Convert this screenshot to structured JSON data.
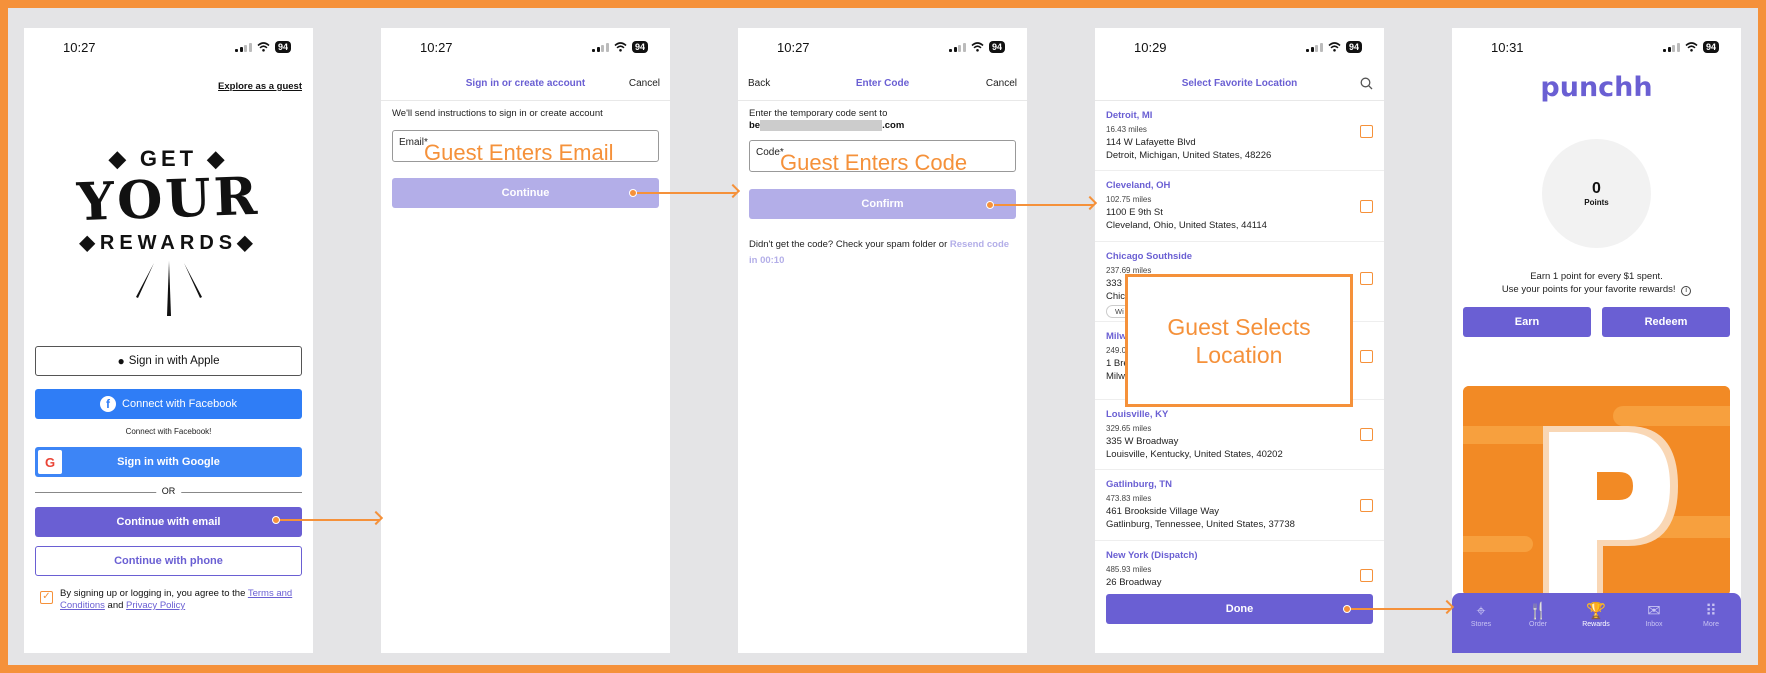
{
  "colors": {
    "accent": "#f5913a",
    "brand_purple": "#6a5fd3",
    "lavender": "#b3aee8",
    "facebook_blue": "#2f7df6"
  },
  "screen1": {
    "time": "10:27",
    "battery": "94",
    "explore": "Explore as a guest",
    "logo_line1": "GET",
    "logo_line2": "YOUR",
    "logo_line3": "REWARDS",
    "apple": "Sign in with Apple",
    "facebook": "Connect with Facebook",
    "facebook_note": "Connect with Facebook!",
    "google": "Sign in with Google",
    "or": "OR",
    "email": "Continue with email",
    "phone": "Continue with phone",
    "terms_prefix": "By signing up or logging in, you agree to the",
    "terms_link": "Terms and Conditions",
    "and": "and",
    "privacy_link": "Privacy Policy"
  },
  "screen2": {
    "time": "10:27",
    "battery": "94",
    "title": "Sign in or create account",
    "cancel": "Cancel",
    "instructions": "We'll send instructions to sign in or create account",
    "email_label": "Email*",
    "continue": "Continue",
    "overlay": "Guest Enters Email"
  },
  "screen3": {
    "time": "10:27",
    "battery": "94",
    "back": "Back",
    "title": "Enter Code",
    "cancel": "Cancel",
    "sent_to": "Enter the temporary code sent to",
    "email_prefix": "be",
    "email_suffix": ".com",
    "code_label": "Code*",
    "confirm": "Confirm",
    "help": "Didn't get the code? Check your spam folder or",
    "resend": "Resend code in 00:10",
    "overlay": "Guest Enters Code"
  },
  "screen4": {
    "time": "10:29",
    "battery": "94",
    "title": "Select Favorite Location",
    "locations": [
      {
        "name": "Detroit, MI",
        "miles": "16.43 miles",
        "addr1": "114 W Lafayette Blvd",
        "addr2": "Detroit, Michigan, United States, 48226"
      },
      {
        "name": "Cleveland, OH",
        "miles": "102.75 miles",
        "addr1": "1100 E 9th St",
        "addr2": "Cleveland, Ohio, United States, 44114"
      },
      {
        "name": "Chicago Southside",
        "miles": "237.69 miles",
        "addr1": "333 1",
        "addr2": "Chic",
        "chip": "Wi"
      },
      {
        "name": "Milw",
        "miles": "249.0",
        "addr1": "1 Bre",
        "addr2": "Milw"
      },
      {
        "name": "Louisville, KY",
        "miles": "329.65 miles",
        "addr1": "335 W Broadway",
        "addr2": "Louisville, Kentucky, United States, 40202"
      },
      {
        "name": "Gatlinburg, TN",
        "miles": "473.83 miles",
        "addr1": "461 Brookside Village Way",
        "addr2": "Gatlinburg, Tennessee, United States, 37738"
      },
      {
        "name": "New York (Dispatch)",
        "miles": "485.93 miles",
        "addr1": "26 Broadway",
        "addr2": ""
      }
    ],
    "done": "Done",
    "overlay_line1": "Guest Selects",
    "overlay_line2": "Location"
  },
  "screen5": {
    "time": "10:31",
    "battery": "94",
    "brand": "punchh",
    "points_value": "0",
    "points_label": "Points",
    "earn_text": "Earn 1 point for every $1 spent.",
    "use_text": "Use your points for your favorite rewards!",
    "earn": "Earn",
    "redeem": "Redeem",
    "tabs": [
      {
        "label": "Stores",
        "icon": "pin-icon"
      },
      {
        "label": "Order",
        "icon": "utensils-icon"
      },
      {
        "label": "Rewards",
        "icon": "trophy-icon"
      },
      {
        "label": "Inbox",
        "icon": "mail-icon"
      },
      {
        "label": "More",
        "icon": "grid-icon"
      }
    ]
  }
}
